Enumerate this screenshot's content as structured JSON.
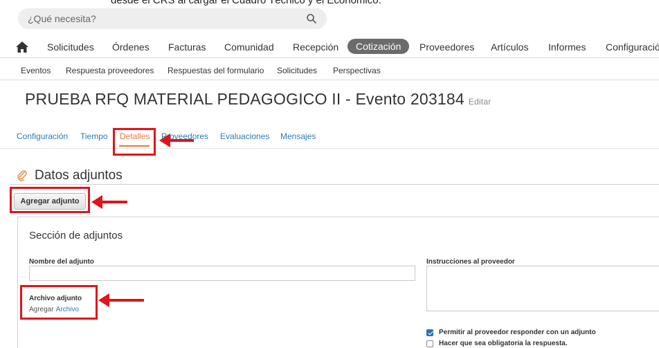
{
  "top_cut_text": "desde el CRS al cargar el Cuadro Técnico y el Economico.",
  "search": {
    "placeholder": "¿Qué necesita?"
  },
  "main_nav": {
    "items": [
      "Solicitudes",
      "Órdenes",
      "Facturas",
      "Comunidad",
      "Recepción",
      "Cotización",
      "Proveedores",
      "Artículos",
      "Informes",
      "Configuració"
    ],
    "active": "Cotización"
  },
  "sub_nav": {
    "items": [
      "Eventos",
      "Respuesta proveedores",
      "Respuestas del formulario",
      "Solicitudes",
      "Perspectivas"
    ]
  },
  "page": {
    "title": "PRUEBA RFQ MATERIAL PEDAGOGICO II - Evento 203184",
    "edit_label": "Editar"
  },
  "tabs": {
    "items": [
      "Configuración",
      "Tiempo",
      "Detalles",
      "Proveedores",
      "Evaluaciones",
      "Mensajes"
    ],
    "active": "Detalles"
  },
  "section": {
    "title": "Datos adjuntos",
    "add_button": "Agregar adjunto"
  },
  "panel": {
    "title": "Sección de adjuntos",
    "name_label": "Nombre del adjunto",
    "file_label": "Archivo adjunto",
    "file_add": "Agregar",
    "file_link": "Archivo",
    "instructions_label": "Instrucciones al proveedor",
    "checkboxes": [
      {
        "label": "Permitir al proveedor responder con un adjunto",
        "checked": true
      },
      {
        "label": "Hacer que sea obligatoria la respuesta.",
        "checked": false
      }
    ]
  },
  "colors": {
    "accent": "#e07a3c",
    "link": "#2a7ab8",
    "annotation": "#e0141b",
    "active_nav": "#6b6b6b"
  }
}
